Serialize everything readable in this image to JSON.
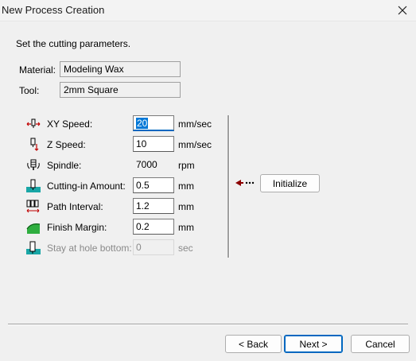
{
  "window": {
    "title": "New Process Creation",
    "close_icon": "close-icon"
  },
  "instructions": "Set the cutting parameters.",
  "material": {
    "label": "Material:",
    "value": "Modeling Wax"
  },
  "tool": {
    "label": "Tool:",
    "value": "2mm Square"
  },
  "params": [
    {
      "label": "XY Speed:",
      "value": "20",
      "unit": "mm/sec",
      "icon": "xy-speed-icon",
      "state": "focused"
    },
    {
      "label": "Z Speed:",
      "value": "10",
      "unit": "mm/sec",
      "icon": "z-speed-icon",
      "state": "normal"
    },
    {
      "label": "Spindle:",
      "value": "7000",
      "unit": "rpm",
      "icon": "spindle-icon",
      "state": "static"
    },
    {
      "label": "Cutting-in Amount:",
      "value": "0.5",
      "unit": "mm",
      "icon": "cutting-in-icon",
      "state": "normal"
    },
    {
      "label": "Path Interval:",
      "value": "1.2",
      "unit": "mm",
      "icon": "path-interval-icon",
      "state": "normal"
    },
    {
      "label": "Finish Margin:",
      "value": "0.2",
      "unit": "mm",
      "icon": "finish-margin-icon",
      "state": "normal"
    },
    {
      "label": "Stay at hole bottom:",
      "value": "0",
      "unit": "sec",
      "icon": "stay-hole-bottom-icon",
      "state": "disabled"
    }
  ],
  "initialize": {
    "label": "Initialize",
    "arrow_icon": "arrow-left-icon"
  },
  "footer": {
    "back_label": "< Back",
    "next_label": "Next >",
    "cancel_label": "Cancel"
  },
  "colors": {
    "accent": "#0067c0",
    "selection": "#0078d7",
    "dialog_bg": "#f0f0f0",
    "arrow": "#8b0000"
  }
}
